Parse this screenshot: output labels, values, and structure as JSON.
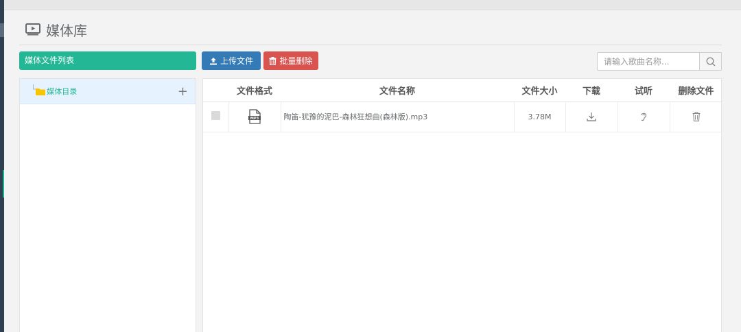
{
  "page": {
    "title": "媒体库"
  },
  "tree": {
    "header": "媒体文件列表",
    "root_label": "媒体目录",
    "add_symbol": "+"
  },
  "toolbar": {
    "upload_label": "上传文件",
    "batch_delete_label": "批量删除"
  },
  "search": {
    "placeholder": "请输入歌曲名称..."
  },
  "table": {
    "columns": [
      "",
      "文件格式",
      "文件名称",
      "文件大小",
      "下载",
      "试听",
      "删除文件"
    ],
    "rows": [
      {
        "format_icon": "mp3-file-icon",
        "name": "陶笛-犹豫的泥巴-森林狂想曲(森林版).mp3",
        "size": "3.78M"
      }
    ]
  },
  "colors": {
    "green": "#23b795",
    "blue": "#337ab7",
    "red": "#d9534f"
  }
}
